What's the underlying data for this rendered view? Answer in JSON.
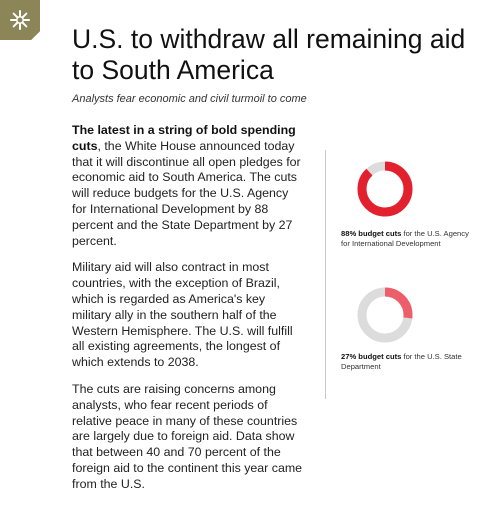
{
  "badge": {
    "icon": "asterisk-icon",
    "color": "#8c8557"
  },
  "headline": "U.S. to withdraw all remaining aid to South America",
  "dek": "Analysts fear economic and civil turmoil to come",
  "body": {
    "lead": "The latest in a string of bold spending cuts",
    "p1_rest": ", the White House announced today that it will discontinue all open pledges for economic aid to South America. The cuts will reduce budgets for the U.S. Agency for International Development by 88 percent and the State Department by 27 percent.",
    "p2": "Military aid will also contract in most countries, with the exception of Brazil, which is regarded as America's key military ally in the southern half of the Western Hemisphere. The U.S. will fulfill all existing agreements, the longest of which extends to 2038.",
    "p3": "The cuts are raising concerns among analysts, who fear recent periods of relative peace in many of these countries are largely due to foreign aid. Data show that between 40 and 70 percent of the foreign aid to the continent this year came from the U.S."
  },
  "chart_data": [
    {
      "type": "pie",
      "style": "donut",
      "values": [
        88,
        12
      ],
      "colors": [
        "#e3212e",
        "#dcdcdc"
      ],
      "label_bold": "88% budget cuts",
      "label_rest": " for the U.S. Agency for International Development"
    },
    {
      "type": "pie",
      "style": "donut",
      "values": [
        27,
        73
      ],
      "colors": [
        "#ec5f6a",
        "#dcdcdc"
      ],
      "label_bold": "27% budget cuts",
      "label_rest": " for the U.S. State Department"
    }
  ]
}
